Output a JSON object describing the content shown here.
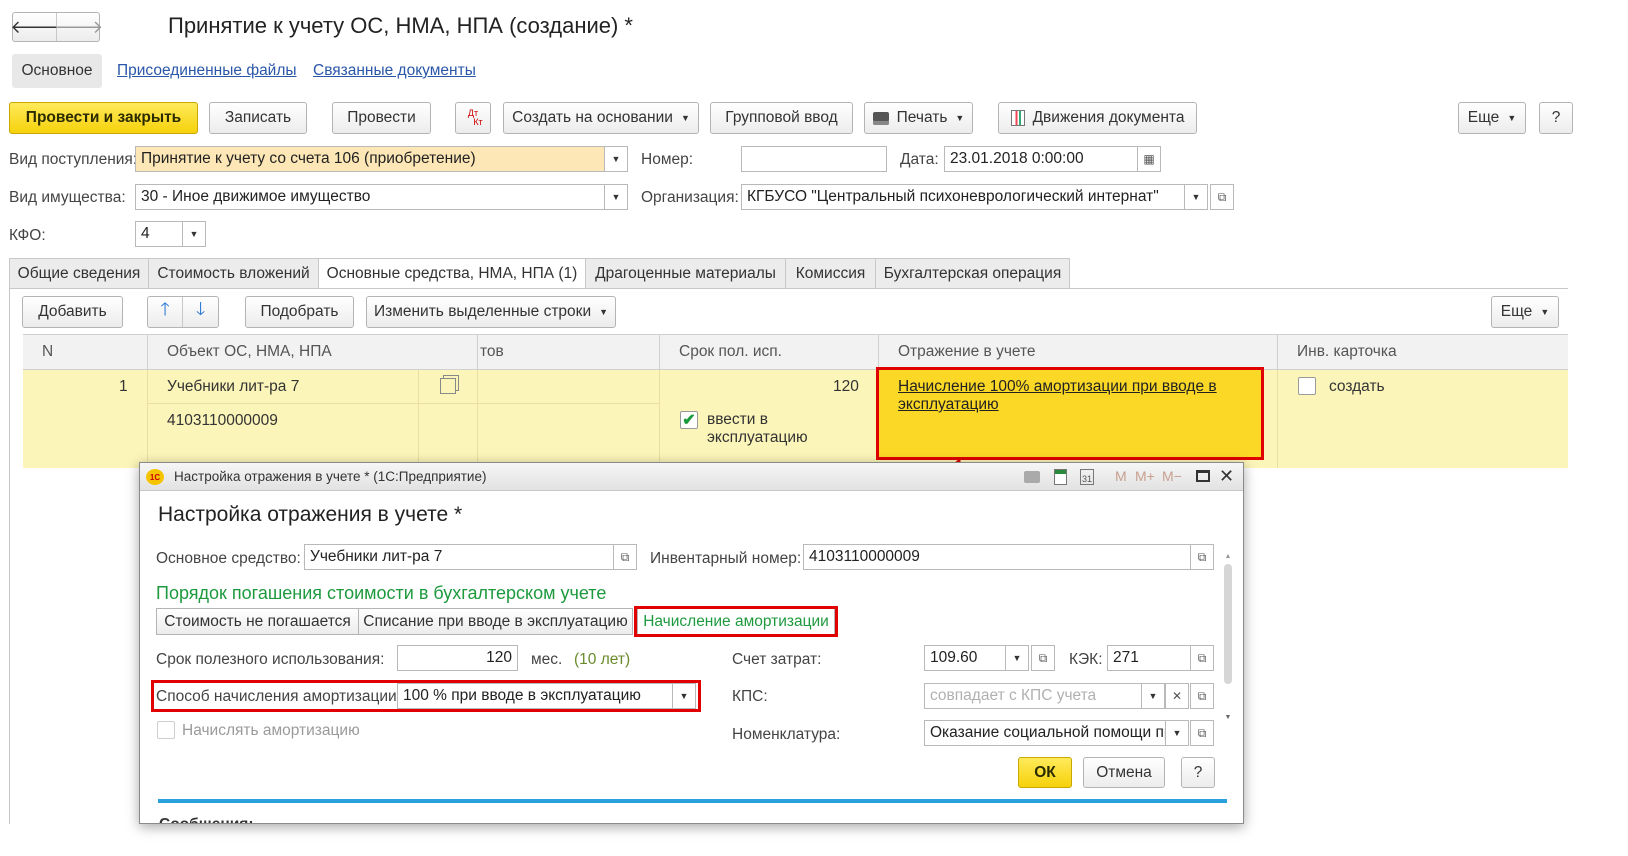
{
  "window": {
    "title": "Принятие к учету ОС, НМА, НПА (создание) *"
  },
  "nav": {
    "back": "🡐",
    "forward": "🡒"
  },
  "sections": {
    "main": "Основное",
    "files": "Присоединенные файлы",
    "docs": "Связанные документы"
  },
  "toolbar": {
    "post_close": "Провести и закрыть",
    "save": "Записать",
    "post": "Провести",
    "dtkt_top": "Дт",
    "dtkt_bottom": "Кт",
    "create_based": "Создать на основании",
    "group_input": "Групповой ввод",
    "print": "Печать",
    "movements": "Движения документа",
    "more": "Еще",
    "help": "?"
  },
  "header": {
    "receipt_type_label": "Вид поступления:",
    "receipt_type_value": "Принятие к учету со счета 106 (приобретение)",
    "number_label": "Номер:",
    "number_value": "",
    "date_label": "Дата:",
    "date_value": "23.01.2018  0:00:00",
    "property_type_label": "Вид имущества:",
    "property_type_value": "30 - Иное движимое имущество",
    "org_label": "Организация:",
    "org_value": "КГБУСО \"Центральный психоневрологический интернат\"",
    "kfo_label": "КФО:",
    "kfo_value": "4"
  },
  "tabs": [
    {
      "label": "Общие сведения"
    },
    {
      "label": "Стоимость вложений"
    },
    {
      "label": "Основные средства, НМА, НПА (1)"
    },
    {
      "label": "Драгоценные материалы"
    },
    {
      "label": "Комиссия"
    },
    {
      "label": "Бухгалтерская операция"
    }
  ],
  "table_toolbar": {
    "add": "Добавить",
    "up": "🡑",
    "down": "🡓",
    "pick": "Подобрать",
    "change_rows": "Изменить выделенные строки",
    "more": "Еще"
  },
  "table": {
    "headers": {
      "n": "N",
      "object": "Объект ОС, НМА, НПА",
      "cost": "тов",
      "term": "Срок пол. исп.",
      "reflection": "Отражение в учете",
      "card": "Инв. карточка"
    },
    "row": {
      "n": "1",
      "object": "Учебники лит-ра 7",
      "inv": "4103110000009",
      "term": "120",
      "commission_label": "ввести в эксплуатацию",
      "commission_checked": true,
      "reflection": "Начисление 100% амортизации при вводе в эксплуатацию",
      "card_label": "создать",
      "card_checked": false
    }
  },
  "dialog": {
    "title_bar": "Настройка отражения в учете * (1С:Предприятие)",
    "app_icon": "1С",
    "heading": "Настройка отражения в учете *",
    "asset_label": "Основное средство:",
    "asset_value": "Учебники лит-ра 7",
    "inv_label": "Инвентарный номер:",
    "inv_value": "4103110000009",
    "section_title": "Порядок погашения стоимости в бухгалтерском учете",
    "modes": [
      {
        "label": "Стоимость не погашается"
      },
      {
        "label": "Списание при вводе в эксплуатацию"
      },
      {
        "label": "Начисление амортизации"
      }
    ],
    "life_label": "Срок полезного использования:",
    "life_value": "120",
    "life_unit": "мес.",
    "life_years": "(10 лет)",
    "method_label": "Способ начисления амортизации:",
    "method_value": "100 % при вводе в эксплуатацию",
    "accrue_label": "Начислять амортизацию",
    "cost_acc_label": "Счет затрат:",
    "cost_acc_value": "109.60",
    "kek_label": "КЭК:",
    "kek_value": "271",
    "kps_label": "КПС:",
    "kps_placeholder": "совпадает с КПС учета",
    "nomenclature_label": "Номенклатура:",
    "nomenclature_value": "Оказание социальной помощи пр",
    "ok": "ОК",
    "cancel": "Отмена",
    "help": "?",
    "messages": "Сообщения:",
    "titlebar_icons": [
      "M",
      "M+",
      "M−"
    ]
  },
  "colors": {
    "accent_yellow": "#f6d10b",
    "row_highlight": "#fbf5b9",
    "link_blue": "#2a57a8",
    "green": "#1e9a3e",
    "red_mark": "#e00000",
    "progress_blue": "#2aa0dc"
  }
}
